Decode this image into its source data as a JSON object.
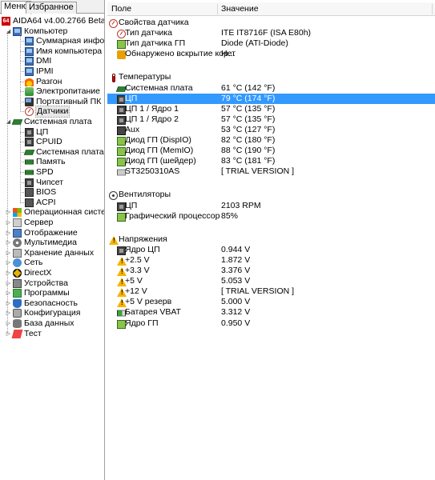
{
  "tabs": [
    "Меню",
    "Избранное"
  ],
  "tree": {
    "app": "AIDA64 v4.00.2766 Beta",
    "computer": "Компьютер",
    "computer_children": [
      {
        "label": "Суммарная информа",
        "icon": "monitor-icon"
      },
      {
        "label": "Имя компьютера",
        "icon": "monitor-icon"
      },
      {
        "label": "DMI",
        "icon": "monitor-icon"
      },
      {
        "label": "IPMI",
        "icon": "monitor-icon"
      },
      {
        "label": "Разгон",
        "icon": "fire-icon"
      },
      {
        "label": "Электропитание",
        "icon": "power-icon"
      },
      {
        "label": "Портативный ПК",
        "icon": "laptop-icon"
      },
      {
        "label": "Датчики",
        "icon": "gauge-icon"
      }
    ],
    "motherboard": "Системная плата",
    "motherboard_children": [
      {
        "label": "ЦП",
        "icon": "cpu-icon"
      },
      {
        "label": "CPUID",
        "icon": "cpu-icon"
      },
      {
        "label": "Системная плата",
        "icon": "motherboard-icon"
      },
      {
        "label": "Память",
        "icon": "ram-icon"
      },
      {
        "label": "SPD",
        "icon": "ram-icon"
      },
      {
        "label": "Чипсет",
        "icon": "chip-icon"
      },
      {
        "label": "BIOS",
        "icon": "bios-icon"
      },
      {
        "label": "ACPI",
        "icon": "bios-icon"
      }
    ],
    "roots": [
      {
        "label": "Операционная система",
        "icon": "windows-icon"
      },
      {
        "label": "Сервер",
        "icon": "server-icon"
      },
      {
        "label": "Отображение",
        "icon": "display-icon"
      },
      {
        "label": "Мультимедиа",
        "icon": "multimedia-icon"
      },
      {
        "label": "Хранение данных",
        "icon": "storage-icon"
      },
      {
        "label": "Сеть",
        "icon": "network-icon"
      },
      {
        "label": "DirectX",
        "icon": "directx-icon"
      },
      {
        "label": "Устройства",
        "icon": "devices-icon"
      },
      {
        "label": "Программы",
        "icon": "programs-icon"
      },
      {
        "label": "Безопасность",
        "icon": "security-icon"
      },
      {
        "label": "Конфигурация",
        "icon": "config-icon"
      },
      {
        "label": "База данных",
        "icon": "database-icon"
      },
      {
        "label": "Тест",
        "icon": "benchmark-icon"
      }
    ]
  },
  "columns": {
    "field": "Поле",
    "value": "Значение"
  },
  "groups": [
    {
      "title": "Свойства датчика",
      "icon": "gauge-icon",
      "rows": [
        {
          "field": "Тип датчика",
          "value": "ITE IT8716F  (ISA E80h)",
          "icon": "gauge-icon"
        },
        {
          "field": "Тип датчика ГП",
          "value": "Diode  (ATI-Diode)",
          "icon": "gpu-icon"
        },
        {
          "field": "Обнаружено вскрытие кор...",
          "value": "Нет",
          "icon": "lock-icon"
        }
      ]
    },
    {
      "title": "Температуры",
      "icon": "thermometer-icon",
      "rows": [
        {
          "field": "Системная плата",
          "value": "61 °C  (142 °F)",
          "icon": "motherboard-icon"
        },
        {
          "field": "ЦП",
          "value": "79 °C  (174 °F)",
          "icon": "cpu-icon",
          "selected": true
        },
        {
          "field": "ЦП 1 / Ядро 1",
          "value": "57 °C  (135 °F)",
          "icon": "cpu-icon"
        },
        {
          "field": "ЦП 1 / Ядро 2",
          "value": "57 °C  (135 °F)",
          "icon": "cpu-icon"
        },
        {
          "field": "Aux",
          "value": "53 °C  (127 °F)",
          "icon": "aux-icon"
        },
        {
          "field": "Диод ГП (DispIO)",
          "value": "82 °C  (180 °F)",
          "icon": "gpu-icon"
        },
        {
          "field": "Диод ГП (MemIO)",
          "value": "88 °C  (190 °F)",
          "icon": "gpu-icon"
        },
        {
          "field": "Диод ГП (шейдер)",
          "value": "83 °C  (181 °F)",
          "icon": "gpu-icon"
        },
        {
          "field": "ST3250310AS",
          "value": "[ TRIAL VERSION ]",
          "icon": "hdd-icon"
        }
      ]
    },
    {
      "title": "Вентиляторы",
      "icon": "fan-icon",
      "rows": [
        {
          "field": "ЦП",
          "value": "2103 RPM",
          "icon": "cpu-icon"
        },
        {
          "field": "Графический процессор",
          "value": "85%",
          "icon": "gpu-icon"
        }
      ]
    },
    {
      "title": "Напряжения",
      "icon": "warning-icon",
      "rows": [
        {
          "field": "Ядро ЦП",
          "value": "0.944 V",
          "icon": "cpu-icon"
        },
        {
          "field": "+2.5 V",
          "value": "1.872 V",
          "icon": "warning-icon"
        },
        {
          "field": "+3.3 V",
          "value": "3.376 V",
          "icon": "warning-icon"
        },
        {
          "field": "+5 V",
          "value": "5.053 V",
          "icon": "warning-icon"
        },
        {
          "field": "+12 V",
          "value": "[ TRIAL VERSION ]",
          "icon": "warning-icon"
        },
        {
          "field": "+5 V резерв",
          "value": "5.000 V",
          "icon": "warning-icon"
        },
        {
          "field": "Батарея VBAT",
          "value": "3.312 V",
          "icon": "battery-icon"
        },
        {
          "field": "Ядро ГП",
          "value": "0.950 V",
          "icon": "gpu-icon"
        }
      ]
    }
  ]
}
